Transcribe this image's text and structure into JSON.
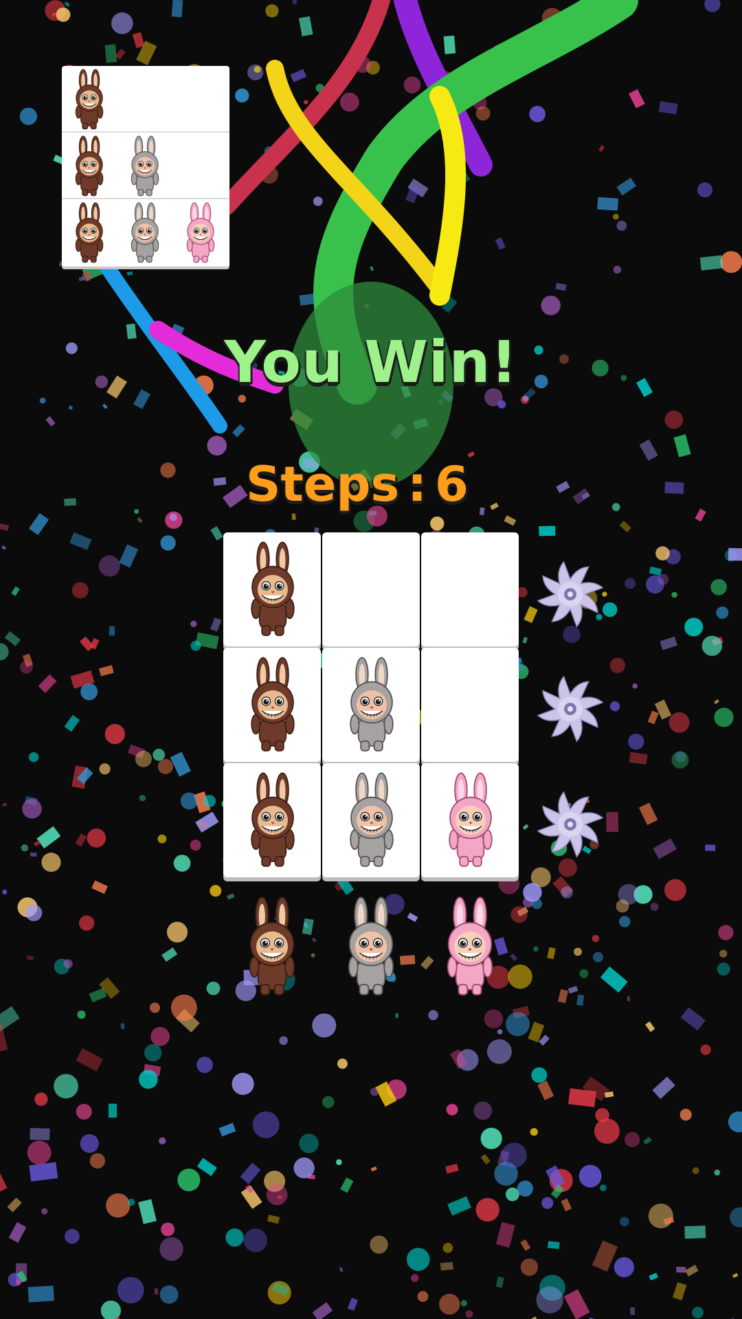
{
  "game": {
    "status": "You Win!",
    "steps_label": "Steps",
    "steps_separator": ":",
    "steps_value": "6"
  },
  "palette": {
    "brown": {
      "fur": "#6e3b2a",
      "face": "#e9b98f",
      "ear": "#f0c9a5",
      "dark": "#3b1d14"
    },
    "gray": {
      "fur": "#a6a2a2",
      "face": "#f1c1a6",
      "ear": "#f0d6c7",
      "dark": "#555050"
    },
    "pink": {
      "fur": "#f4a6c6",
      "face": "#f7cfb9",
      "ear": "#ffd9e8",
      "dark": "#9c4a6c"
    }
  },
  "board": {
    "rows": [
      [
        "brown",
        null,
        null
      ],
      [
        "brown",
        "gray",
        null
      ],
      [
        "brown",
        "gray",
        "pink"
      ]
    ]
  },
  "target_pattern": {
    "rows": [
      [
        "brown",
        null,
        null
      ],
      [
        "brown",
        "gray",
        null
      ],
      [
        "brown",
        "gray",
        "pink"
      ]
    ]
  },
  "tray": [
    "brown",
    "gray",
    "pink"
  ],
  "saw_icons": [
    "saw-blade-icon",
    "saw-blade-icon",
    "saw-blade-icon"
  ]
}
